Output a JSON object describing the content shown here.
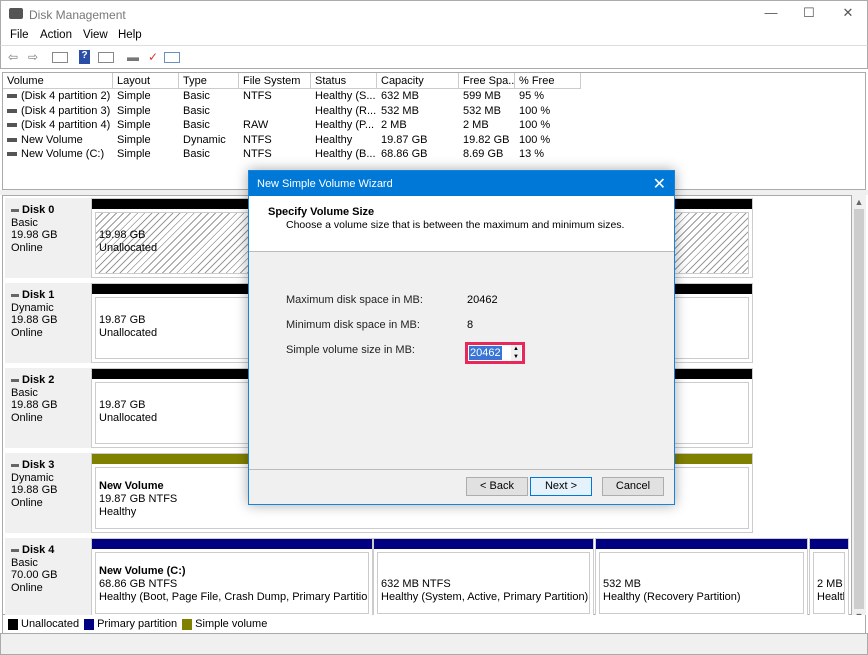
{
  "window": {
    "title": "Disk Management",
    "minimize": "—",
    "maximize": "☐",
    "close": "✕"
  },
  "menu": [
    "File",
    "Action",
    "View",
    "Help"
  ],
  "toolbar": {
    "icons": [
      "back-icon",
      "forward-icon",
      "console-tree-icon",
      "help-icon",
      "action-pane-icon",
      "connect-icon",
      "properties-icon",
      "view-icon"
    ]
  },
  "volume_list": {
    "columns": [
      "Volume",
      "Layout",
      "Type",
      "File System",
      "Status",
      "Capacity",
      "Free Spa...",
      "% Free"
    ],
    "rows": [
      [
        "(Disk 4 partition 2)",
        "Simple",
        "Basic",
        "NTFS",
        "Healthy (S...",
        "632 MB",
        "599 MB",
        "95 %"
      ],
      [
        "(Disk 4 partition 3)",
        "Simple",
        "Basic",
        "",
        "Healthy (R...",
        "532 MB",
        "532 MB",
        "100 %"
      ],
      [
        "(Disk 4 partition 4)",
        "Simple",
        "Basic",
        "RAW",
        "Healthy (P...",
        "2 MB",
        "2 MB",
        "100 %"
      ],
      [
        "New Volume",
        "Simple",
        "Dynamic",
        "NTFS",
        "Healthy",
        "19.87 GB",
        "19.82 GB",
        "100 %"
      ],
      [
        "New Volume (C:)",
        "Simple",
        "Basic",
        "NTFS",
        "Healthy (B...",
        "68.86 GB",
        "8.69 GB",
        "13 %"
      ]
    ]
  },
  "disks": [
    {
      "name": "Disk 0",
      "type": "Basic",
      "size": "19.98 GB",
      "state": "Online",
      "partitions": [
        {
          "title": "",
          "line1": "19.98 GB",
          "line2": "Unallocated",
          "kind": "unallocated"
        }
      ]
    },
    {
      "name": "Disk 1",
      "type": "Dynamic",
      "size": "19.88 GB",
      "state": "Online",
      "partitions": [
        {
          "title": "",
          "line1": "19.87 GB",
          "line2": "Unallocated",
          "kind": "unallocated"
        }
      ]
    },
    {
      "name": "Disk 2",
      "type": "Basic",
      "size": "19.88 GB",
      "state": "Online",
      "partitions": [
        {
          "title": "",
          "line1": "19.87 GB",
          "line2": "Unallocated",
          "kind": "unallocated"
        }
      ]
    },
    {
      "name": "Disk 3",
      "type": "Dynamic",
      "size": "19.88 GB",
      "state": "Online",
      "partitions": [
        {
          "title": "New Volume",
          "line1": "19.87 GB NTFS",
          "line2": "Healthy",
          "kind": "simple"
        }
      ]
    },
    {
      "name": "Disk 4",
      "type": "Basic",
      "size": "70.00 GB",
      "state": "Online",
      "partitions": [
        {
          "title": "New Volume  (C:)",
          "line1": "68.86 GB NTFS",
          "line2": "Healthy (Boot, Page File, Crash Dump, Primary Partition)",
          "kind": "primary"
        },
        {
          "title": "",
          "line1": "632 MB NTFS",
          "line2": "Healthy (System, Active, Primary Partition)",
          "kind": "primary"
        },
        {
          "title": "",
          "line1": "532 MB",
          "line2": "Healthy (Recovery Partition)",
          "kind": "primary"
        },
        {
          "title": "",
          "line1": "2 MB",
          "line2": "Healtl",
          "kind": "primary"
        }
      ]
    }
  ],
  "legend": [
    {
      "label": "Unallocated",
      "color": "#000000"
    },
    {
      "label": "Primary partition",
      "color": "#000080"
    },
    {
      "label": "Simple volume",
      "color": "#808000"
    }
  ],
  "colors": {
    "unallocated": "#000000",
    "primary": "#000080",
    "simple": "#808000",
    "dialog_title": "#0078d7",
    "highlight": "#e8285a"
  },
  "dialog": {
    "title": "New Simple Volume Wizard",
    "heading": "Specify Volume Size",
    "subheading": "Choose a volume size that is between the maximum and minimum sizes.",
    "max_label": "Maximum disk space in MB:",
    "max_value": "20462",
    "min_label": "Minimum disk space in MB:",
    "min_value": "8",
    "size_label": "Simple volume size in MB:",
    "size_value": "20462",
    "back": "< Back",
    "next": "Next >",
    "cancel": "Cancel",
    "close": "✕"
  }
}
